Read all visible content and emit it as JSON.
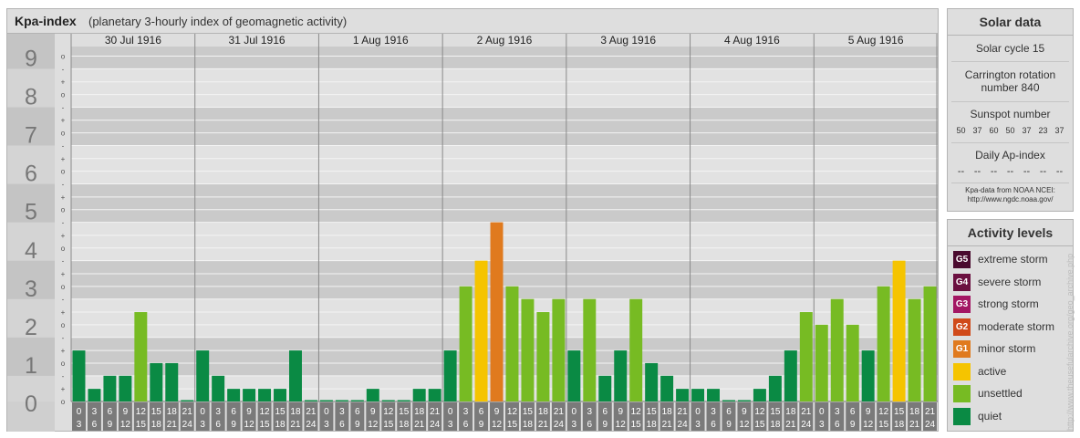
{
  "header": {
    "title": "Kpa-index",
    "subtitle": "(planetary 3-hourly index of geomagnetic activity)"
  },
  "solar": {
    "heading": "Solar data",
    "cycle": "Solar cycle 15",
    "carrington_line1": "Carrington rotation",
    "carrington_line2": "number 840",
    "sunspot_label": "Sunspot number",
    "sunspot_values": [
      "50",
      "37",
      "60",
      "50",
      "37",
      "23",
      "37"
    ],
    "ap_label": "Daily Ap-index",
    "ap_values": [
      "--",
      "--",
      "--",
      "--",
      "--",
      "--",
      "--"
    ],
    "credit_line1": "Kpa-data from NOAA NCEI:",
    "credit_line2": "http://www.ngdc.noaa.gov/"
  },
  "levels": {
    "heading": "Activity levels",
    "items": [
      {
        "badge": "G5",
        "label": "extreme storm",
        "color": "#4a0a2e"
      },
      {
        "badge": "G4",
        "label": "severe storm",
        "color": "#6b1040"
      },
      {
        "badge": "G3",
        "label": "strong storm",
        "color": "#a31663"
      },
      {
        "badge": "G2",
        "label": "moderate storm",
        "color": "#d04a1a"
      },
      {
        "badge": "G1",
        "label": "minor storm",
        "color": "#e07a1e"
      },
      {
        "badge": "",
        "label": "active",
        "color": "#f5c400"
      },
      {
        "badge": "",
        "label": "unsettled",
        "color": "#77bb23"
      },
      {
        "badge": "",
        "label": "quiet",
        "color": "#0a8a44"
      }
    ]
  },
  "watermark": "http://www.theusefularchive.org/geo_archive.php",
  "chart_data": {
    "type": "bar",
    "title": "Kpa-index",
    "subtitle": "(planetary 3-hourly index of geomagnetic activity)",
    "ylim": [
      0,
      9
    ],
    "y_ticks": [
      "0",
      "1",
      "2",
      "3",
      "4",
      "5",
      "6",
      "7",
      "8",
      "9"
    ],
    "y_minor_labels": [
      "o",
      "+",
      "-"
    ],
    "days": [
      "30 Jul 1916",
      "31 Jul 1916",
      "1 Aug 1916",
      "2 Aug 1916",
      "3 Aug 1916",
      "4 Aug 1916",
      "5 Aug 1916"
    ],
    "interval_start": [
      "0",
      "3",
      "6",
      "9",
      "12",
      "15",
      "18",
      "21"
    ],
    "interval_end": [
      "3",
      "6",
      "9",
      "12",
      "15",
      "18",
      "21",
      "24"
    ],
    "values": [
      [
        1.33,
        0.33,
        0.67,
        0.67,
        2.33,
        1.0,
        1.0,
        0.0
      ],
      [
        1.33,
        0.67,
        0.33,
        0.33,
        0.33,
        0.33,
        1.33,
        0.0
      ],
      [
        0.0,
        0.0,
        0.0,
        0.33,
        0.0,
        0.0,
        0.33,
        0.33
      ],
      [
        1.33,
        3.0,
        3.67,
        4.67,
        3.0,
        2.67,
        2.33,
        2.67
      ],
      [
        1.33,
        2.67,
        0.67,
        1.33,
        2.67,
        1.0,
        0.67,
        0.33
      ],
      [
        0.33,
        0.33,
        0.0,
        0.0,
        0.33,
        0.67,
        1.33,
        2.33
      ],
      [
        2.0,
        2.67,
        2.0,
        1.33,
        3.0,
        3.67,
        2.67,
        3.0
      ]
    ],
    "color_scale": {
      "quiet": "#0a8a44",
      "unsettled": "#77bb23",
      "active": "#f5c400",
      "minor_storm": "#e07a1e"
    }
  }
}
